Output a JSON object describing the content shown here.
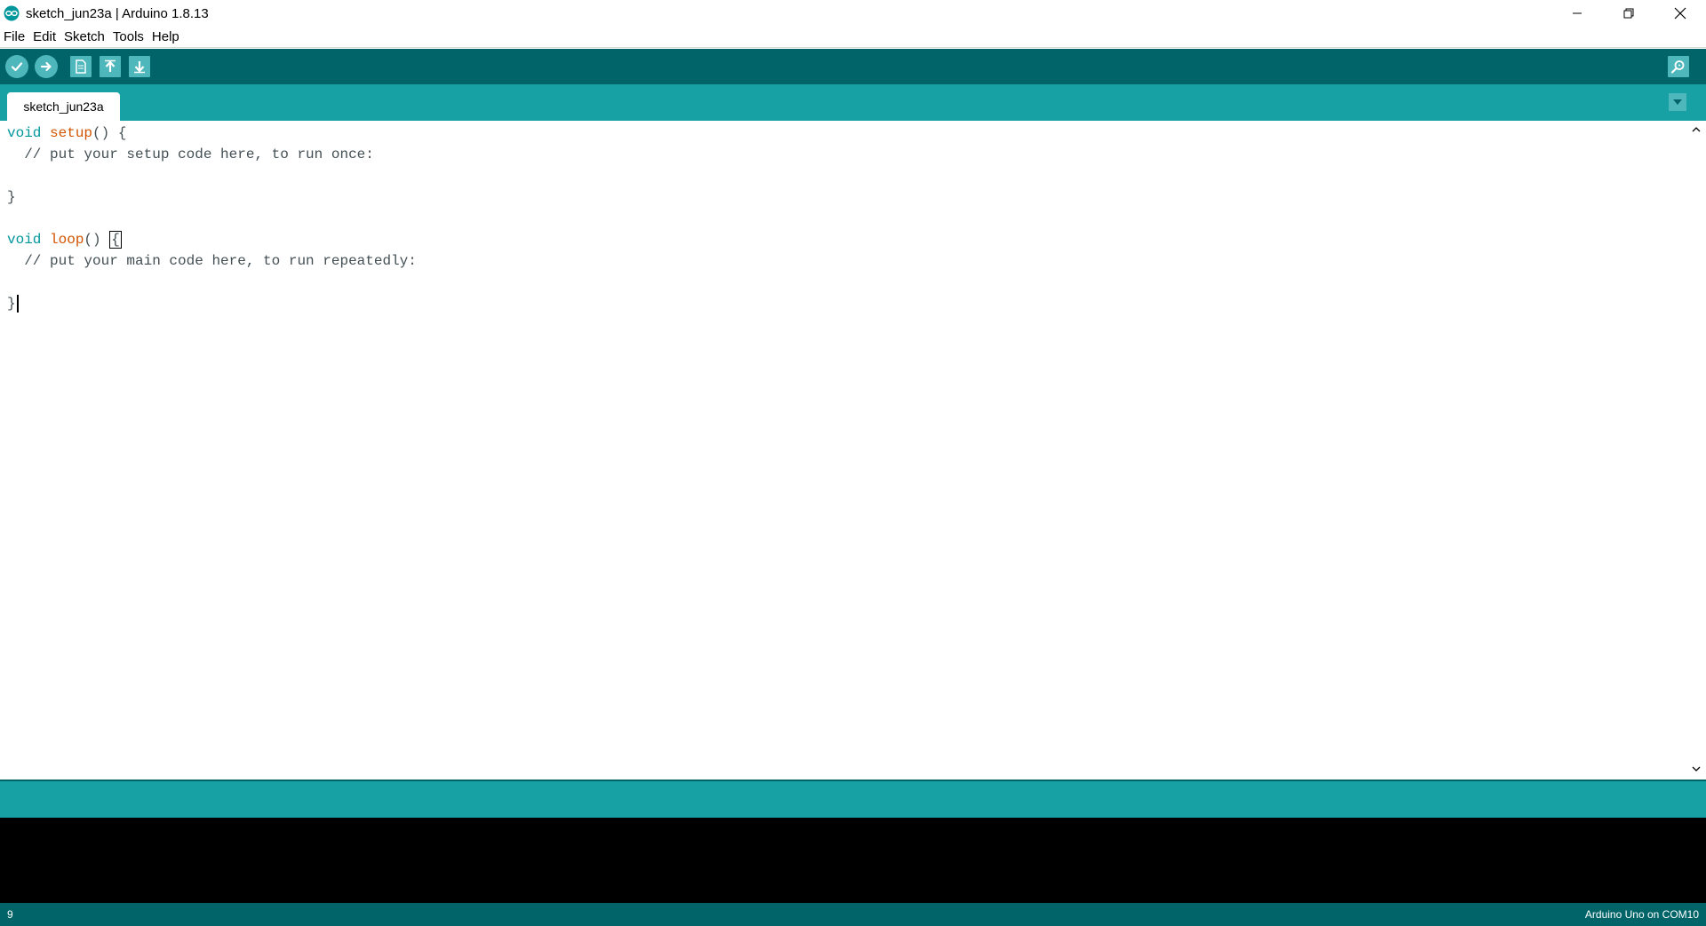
{
  "window": {
    "title": "sketch_jun23a | Arduino 1.8.13",
    "icon": "arduino-infinity-icon",
    "controls": [
      "minimize-icon",
      "restore-icon",
      "close-icon"
    ]
  },
  "menu": {
    "items": [
      "File",
      "Edit",
      "Sketch",
      "Tools",
      "Help"
    ]
  },
  "toolbar": {
    "buttons": [
      "verify-icon",
      "upload-icon",
      "new-icon",
      "open-icon",
      "save-icon"
    ],
    "serial_monitor": "serial-monitor-icon"
  },
  "tabs": {
    "active": "sketch_jun23a",
    "menu_icon": "chevron-down-icon"
  },
  "editor": {
    "lines": {
      "l1_kw": "void",
      "l1_fn": "setup",
      "l1_rest": "() {",
      "l2": "  // put your setup code here, to run once:",
      "l3": "",
      "l4": "}",
      "l5": "",
      "l6_kw": "void",
      "l6_fn": "loop",
      "l6_rest": "() ",
      "l6_brace": "{",
      "l7": "  // put your main code here, to run repeatedly:",
      "l8": "",
      "l9": "}"
    }
  },
  "footer": {
    "line_number": "9",
    "board": "Arduino Uno on COM10"
  },
  "colors": {
    "toolbar": "#006468",
    "tabstrip": "#17a1a5",
    "button": "#4db7bb",
    "keyword": "#00979c",
    "function": "#d35400",
    "console": "#000000"
  }
}
